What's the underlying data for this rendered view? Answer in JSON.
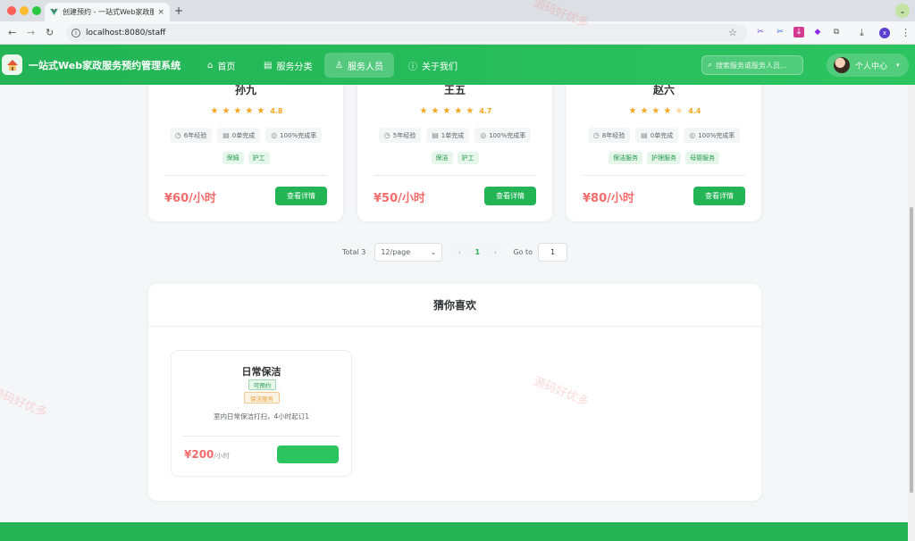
{
  "browser": {
    "tab_title": "创建预约 - 一站式Web家政服务",
    "tab_close": "×",
    "new_tab": "+",
    "url": "localhost:8080/staff",
    "nav_back": "←",
    "nav_forward": "→",
    "nav_reload": "↻",
    "bookmark": "☆",
    "download": "⤓",
    "menu": "⋮",
    "profile": "x",
    "tab_menu": "⌄"
  },
  "header": {
    "brand": "一站式Web家政服务预约管理系统",
    "nav": [
      {
        "label": "首页",
        "icon": "⌂",
        "active": false
      },
      {
        "label": "服务分类",
        "icon": "▤",
        "active": false
      },
      {
        "label": "服务人员",
        "icon": "♙",
        "active": true
      },
      {
        "label": "关于我们",
        "icon": "ⓘ",
        "active": false
      }
    ],
    "search_placeholder": "搜索服务或服务人员...",
    "search_icon": "⌕",
    "user_label": "个人中心",
    "user_caret": "▾"
  },
  "staff": [
    {
      "name": "孙九",
      "rating": "4.8",
      "exp": "6年经验",
      "orders": "0单完成",
      "rate": "100%完成率",
      "tags": [
        "保姆",
        "护工"
      ],
      "price": "¥60/小时",
      "button": "查看详情"
    },
    {
      "name": "王五",
      "rating": "4.7",
      "exp": "5年经验",
      "orders": "1单完成",
      "rate": "100%完成率",
      "tags": [
        "保洁",
        "护工"
      ],
      "price": "¥50/小时",
      "button": "查看详情"
    },
    {
      "name": "赵六",
      "rating": "4.4",
      "exp": "8年经验",
      "orders": "0单完成",
      "rate": "100%完成率",
      "tags": [
        "保洁服务",
        "护理服务",
        "母婴服务"
      ],
      "price": "¥80/小时",
      "button": "查看详情"
    }
  ],
  "stat_icons": {
    "exp": "◷",
    "orders": "▤",
    "rate": "◎"
  },
  "star_glyph": "★",
  "pagination": {
    "total": "Total 3",
    "page_size": "12/page",
    "size_caret": "⌄",
    "prev": "‹",
    "current": "1",
    "next": "›",
    "goto_label": "Go to",
    "goto_value": "1"
  },
  "recommend": {
    "title": "猜你喜欢",
    "item": {
      "name": "日常保洁",
      "status": "可预约",
      "category": "保洁服务",
      "desc": "室内日常保洁打扫，4小时起订1",
      "price": "¥200",
      "unit": "/小时"
    }
  },
  "watermark": "源码好优多",
  "colors": {
    "primary": "#22b455",
    "price": "#f56c6c",
    "star": "#f5a623"
  }
}
